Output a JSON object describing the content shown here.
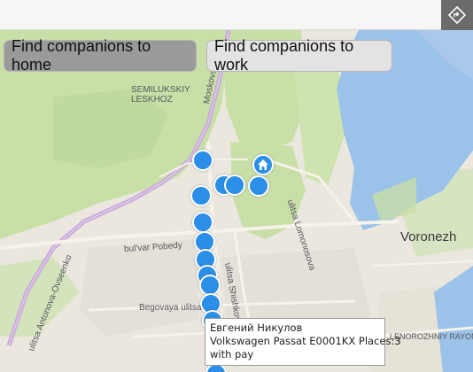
{
  "toolbar": {
    "nav_icon": "navigation-diamond-icon"
  },
  "buttons": {
    "home_label": "Find companions to home",
    "work_label": "Find companions to work"
  },
  "map": {
    "labels": {
      "semiluksky": "SEMILUKSKIY",
      "leskhoz": "LESKHOZ",
      "moskovskiy": "Moskovskiy",
      "pobedy": "bul'var Pobedy",
      "shishkova": "ulitsa Shishkova",
      "lomonosova": "ulitsa Lomonosova",
      "antonova": "ulitsa Antonova-Ovseenko",
      "begovaya": "Begovaya ulitsa",
      "voronezh": "Voronezh",
      "levoberezhny": "LENOROZHNIY RAYON"
    },
    "colors": {
      "water": "#9bc2e8",
      "park": "#c9dfa8",
      "road": "#f5f2ea",
      "highway": "#c8a8d8",
      "point": "#2b8fe8"
    }
  },
  "tooltip": {
    "driver": "Евгений Никулов",
    "car": "Volkswagen Passat E0001KX Places:3",
    "payment": "with pay"
  }
}
